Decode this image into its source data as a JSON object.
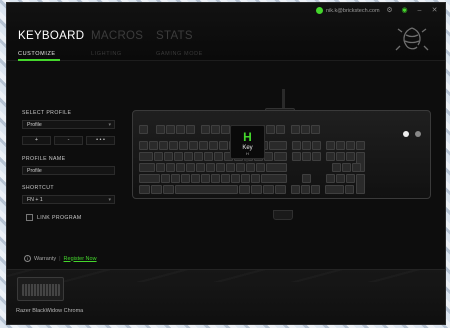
{
  "header": {
    "tabs": [
      {
        "label": "KEYBOARD",
        "active": true
      },
      {
        "label": "MACROS",
        "active": false
      },
      {
        "label": "STATS",
        "active": false
      }
    ],
    "subtabs": [
      {
        "label": "CUSTOMIZE",
        "active": true
      },
      {
        "label": "LIGHTING",
        "active": false
      },
      {
        "label": "GAMING MODE",
        "active": false
      }
    ],
    "account_email": "nik.k@brickstech.com",
    "window_icons": [
      "gear-icon",
      "chat-icon",
      "minimize-icon",
      "close-icon"
    ],
    "accent_color": "#44d62c"
  },
  "left_panel": {
    "select_profile_label": "SELECT PROFILE",
    "profile_value": "Profile",
    "profile_buttons": [
      "+",
      "-",
      "• • •"
    ],
    "profile_name_label": "PROFILE NAME",
    "profile_name_value": "Profile",
    "shortcut_label": "SHORTCUT",
    "shortcut_value": "FN + 1",
    "link_program_label": "LINK PROGRAM"
  },
  "keyboard": {
    "tooltip_key": "H",
    "tooltip_label": "Key",
    "tooltip_sub": "H"
  },
  "footer": {
    "warranty_label": "Warranty",
    "register_link": "Register Now",
    "device_name": "Razer BlackWidow Chroma"
  }
}
